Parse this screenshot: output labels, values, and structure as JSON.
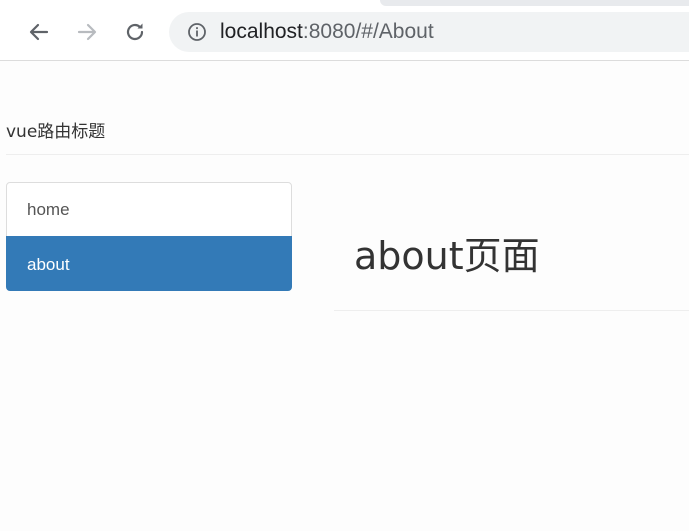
{
  "browser": {
    "url_host": "localhost",
    "url_rest": ":8080/#/About",
    "icons": {
      "back": "back-arrow-icon",
      "forward": "forward-arrow-icon",
      "reload": "reload-icon",
      "info": "info-icon"
    }
  },
  "app": {
    "title": "vue路由标题"
  },
  "nav": {
    "items": [
      {
        "label": "home",
        "active": false
      },
      {
        "label": "about",
        "active": true
      }
    ]
  },
  "main": {
    "heading": "about页面"
  },
  "colors": {
    "active_item_bg": "#337ab7",
    "text": "#333333"
  }
}
